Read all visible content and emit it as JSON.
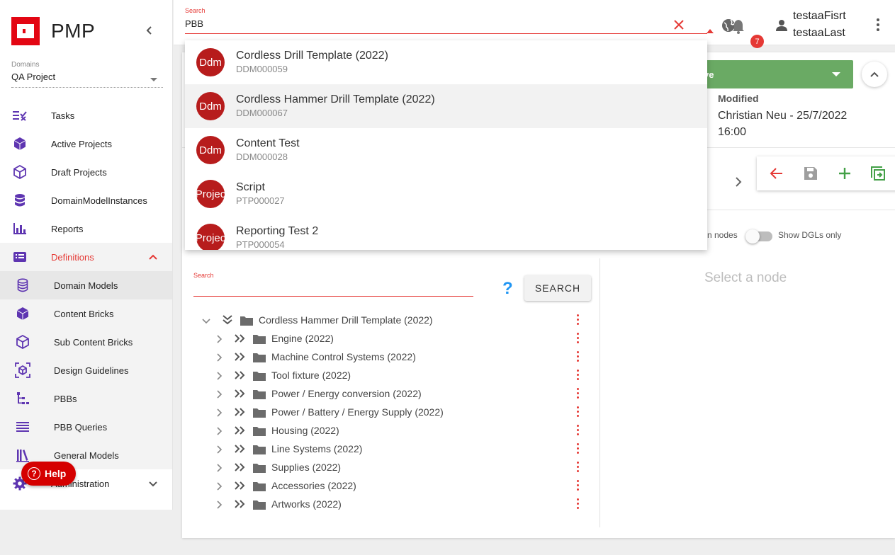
{
  "app": {
    "title": "PMP",
    "brand_color": "#e30613"
  },
  "sidebar": {
    "domain_label": "Domains",
    "domain_value": "QA Project",
    "items": [
      {
        "label": "Tasks",
        "icon": "tasks-icon"
      },
      {
        "label": "Active Projects",
        "icon": "cube-filled-icon"
      },
      {
        "label": "Draft Projects",
        "icon": "cube-outline-icon"
      },
      {
        "label": "DomainModelInstances",
        "icon": "database-icon"
      },
      {
        "label": "Reports",
        "icon": "bar-chart-icon"
      },
      {
        "label": "Definitions",
        "icon": "list-card-icon",
        "expanded": true
      },
      {
        "label": "Domain Models",
        "icon": "database-outline-icon",
        "selected": true
      },
      {
        "label": "Content Bricks",
        "icon": "cube-filled-icon"
      },
      {
        "label": "Sub Content Bricks",
        "icon": "cube-outline-icon"
      },
      {
        "label": "Design Guidelines",
        "icon": "cube-scan-icon"
      },
      {
        "label": "PBBs",
        "icon": "file-tree-icon"
      },
      {
        "label": "PBB Queries",
        "icon": "lines-icon"
      },
      {
        "label": "General Models",
        "icon": "library-icon"
      },
      {
        "label": "Administration",
        "icon": "gear-icon"
      }
    ],
    "help_label": "Help"
  },
  "topbar": {
    "search_label": "Search",
    "search_value": "PBB",
    "notification_count": "7",
    "user_first": "testaaFisrt",
    "user_last": "testaaLast"
  },
  "dropdown": {
    "items": [
      {
        "avatar": "Ddm",
        "title": "Cordless Drill Template (2022)",
        "code": "DDM000059"
      },
      {
        "avatar": "Ddm",
        "title": "Cordless Hammer Drill Template (2022)",
        "code": "DDM000067",
        "hover": true
      },
      {
        "avatar": "Ddm",
        "title": "Content Test",
        "code": "DDM000028"
      },
      {
        "avatar": "Projec",
        "title": "Script",
        "code": "PTP000027"
      },
      {
        "avatar": "Projec",
        "title": "Reporting Test 2",
        "code": "PTP000054"
      }
    ]
  },
  "detail": {
    "save_label": "ve",
    "modified_label": "Modified",
    "modified_value": "Christian Neu - 25/7/2022 16:00",
    "nodes_label": "n nodes",
    "dgl_label": "Show DGLs only",
    "select_node": "Select a node",
    "tree_search_label": "Search",
    "search_button": "SEARCH",
    "help_q": "?"
  },
  "tree": {
    "root": "Cordless Hammer Drill Template (2022)",
    "children": [
      "Engine (2022)",
      "Machine Control Systems (2022)",
      "Tool fixture (2022)",
      "Power / Energy conversion (2022)",
      "Power / Battery / Energy Supply (2022)",
      "Housing (2022)",
      "Line Systems (2022)",
      "Supplies (2022)",
      "Accessories (2022)",
      "Artworks (2022)"
    ]
  },
  "colors": {
    "accent_red": "#e53935",
    "nav_icon_purple": "#5e35b1",
    "save_green": "#6aaa64",
    "help_blue": "#2196f3"
  }
}
